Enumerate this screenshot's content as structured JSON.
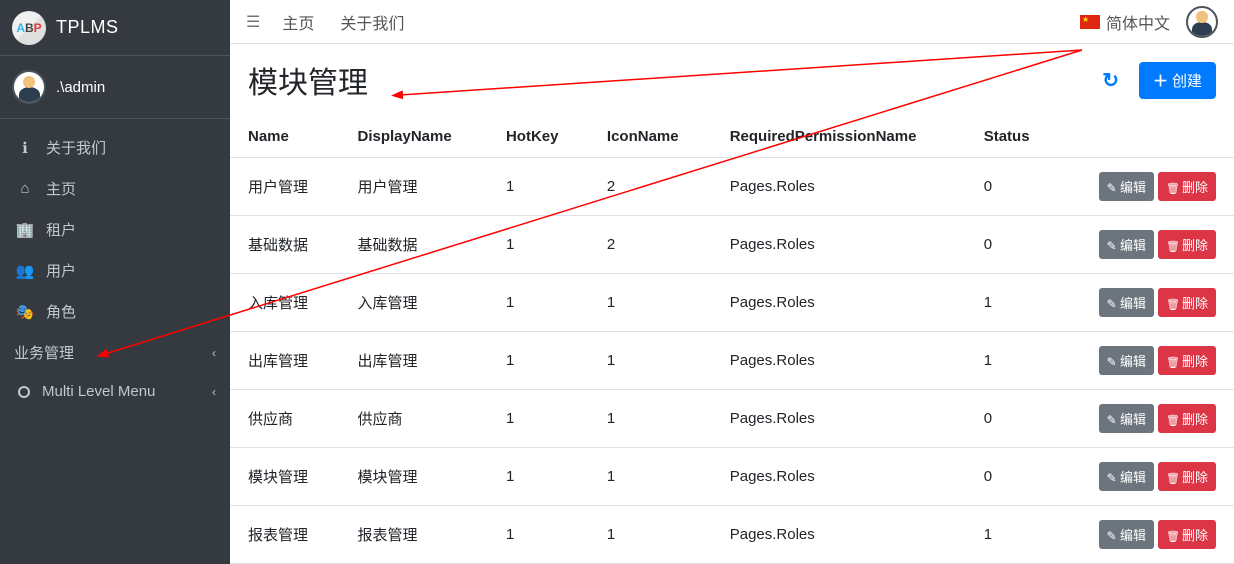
{
  "brand": {
    "name": "TPLMS",
    "logo_letters": [
      "A",
      "B",
      "P"
    ]
  },
  "user": {
    "name": ".\\admin"
  },
  "sidebar": {
    "items": [
      {
        "icon": "ℹ",
        "label": "关于我们"
      },
      {
        "icon": "⌂",
        "label": "主页"
      },
      {
        "icon": "🏢",
        "label": "租户"
      },
      {
        "icon": "👥",
        "label": "用户"
      },
      {
        "icon": "🎭",
        "label": "角色"
      }
    ],
    "biz": {
      "label": "业务管理"
    },
    "multi": {
      "label": "Multi Level Menu"
    }
  },
  "topbar": {
    "links": [
      "主页",
      "关于我们"
    ],
    "lang": "简体中文"
  },
  "page": {
    "title": "模块管理",
    "create": "创建"
  },
  "table": {
    "headers": [
      "Name",
      "DisplayName",
      "HotKey",
      "IconName",
      "RequiredPermissionName",
      "Status"
    ],
    "edit": "编辑",
    "del": "删除",
    "rows": [
      {
        "c": [
          "用户管理",
          "用户管理",
          "1",
          "2",
          "Pages.Roles",
          "0"
        ]
      },
      {
        "c": [
          "基础数据",
          "基础数据",
          "1",
          "2",
          "Pages.Roles",
          "0"
        ]
      },
      {
        "c": [
          "入库管理",
          "入库管理",
          "1",
          "1",
          "Pages.Roles",
          "1"
        ]
      },
      {
        "c": [
          "出库管理",
          "出库管理",
          "1",
          "1",
          "Pages.Roles",
          "1"
        ]
      },
      {
        "c": [
          "供应商",
          "供应商",
          "1",
          "1",
          "Pages.Roles",
          "0"
        ]
      },
      {
        "c": [
          "模块管理",
          "模块管理",
          "1",
          "1",
          "Pages.Roles",
          "0"
        ]
      },
      {
        "c": [
          "报表管理",
          "报表管理",
          "1",
          "1",
          "Pages.Roles",
          "1"
        ]
      }
    ]
  }
}
